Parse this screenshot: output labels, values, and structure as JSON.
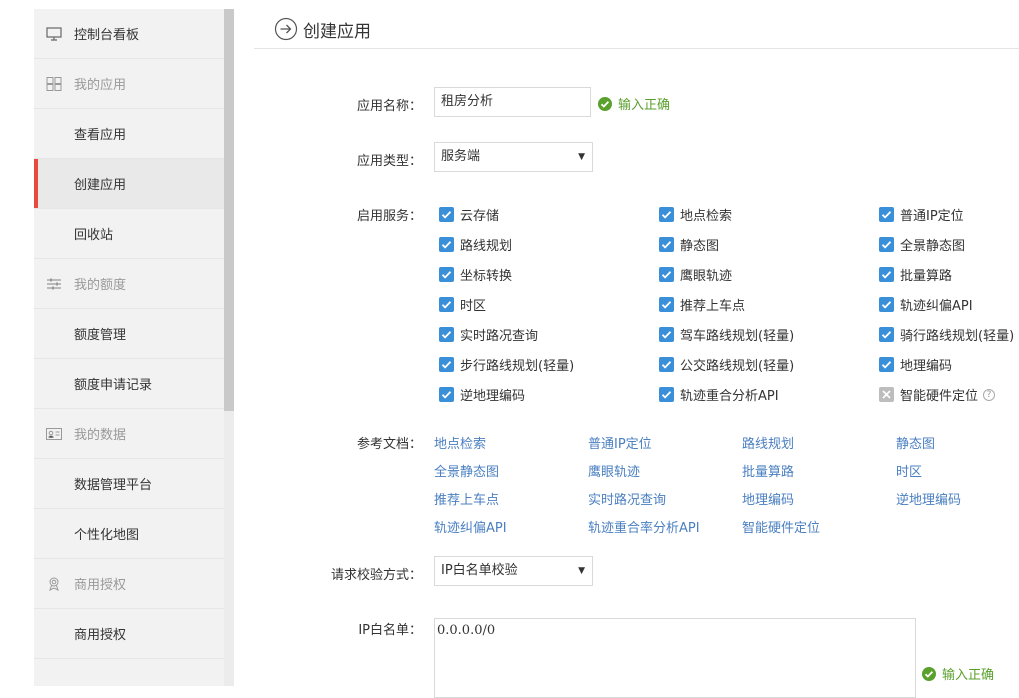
{
  "sidebar": {
    "items": [
      {
        "label": "控制台看板",
        "kind": "top",
        "icon": "monitor-icon"
      },
      {
        "label": "我的应用",
        "kind": "group",
        "icon": "grid-icon"
      },
      {
        "label": "查看应用",
        "kind": "sub"
      },
      {
        "label": "创建应用",
        "kind": "sub",
        "active": true
      },
      {
        "label": "回收站",
        "kind": "sub"
      },
      {
        "label": "我的额度",
        "kind": "group",
        "icon": "sliders-icon"
      },
      {
        "label": "额度管理",
        "kind": "sub"
      },
      {
        "label": "额度申请记录",
        "kind": "sub"
      },
      {
        "label": "我的数据",
        "kind": "group",
        "icon": "id-card-icon"
      },
      {
        "label": "数据管理平台",
        "kind": "sub"
      },
      {
        "label": "个性化地图",
        "kind": "sub"
      },
      {
        "label": "商用授权",
        "kind": "group",
        "icon": "award-icon"
      },
      {
        "label": "商用授权",
        "kind": "sub"
      }
    ]
  },
  "header": {
    "title": "创建应用"
  },
  "form": {
    "app_name": {
      "label": "应用名称：",
      "value": "租房分析",
      "valid": "输入正确"
    },
    "app_type": {
      "label": "应用类型：",
      "value": "服务端"
    },
    "services": {
      "label": "启用服务：",
      "items": [
        {
          "label": "云存储",
          "checked": true
        },
        {
          "label": "地点检索",
          "checked": true
        },
        {
          "label": "普通IP定位",
          "checked": true
        },
        {
          "label": "路线规划",
          "checked": true
        },
        {
          "label": "静态图",
          "checked": true
        },
        {
          "label": "全景静态图",
          "checked": true
        },
        {
          "label": "坐标转换",
          "checked": true
        },
        {
          "label": "鹰眼轨迹",
          "checked": true
        },
        {
          "label": "批量算路",
          "checked": true
        },
        {
          "label": "时区",
          "checked": true
        },
        {
          "label": "推荐上车点",
          "checked": true
        },
        {
          "label": "轨迹纠偏API",
          "checked": true
        },
        {
          "label": "实时路况查询",
          "checked": true
        },
        {
          "label": "驾车路线规划(轻量)",
          "checked": true
        },
        {
          "label": "骑行路线规划(轻量)",
          "checked": true
        },
        {
          "label": "步行路线规划(轻量)",
          "checked": true
        },
        {
          "label": "公交路线规划(轻量)",
          "checked": true
        },
        {
          "label": "地理编码",
          "checked": true
        },
        {
          "label": "逆地理编码",
          "checked": true
        },
        {
          "label": "轨迹重合分析API",
          "checked": true
        },
        {
          "label": "智能硬件定位",
          "checked": false,
          "help": "?"
        }
      ]
    },
    "docs": {
      "label": "参考文档：",
      "links": [
        "地点检索",
        "普通IP定位",
        "路线规划",
        "静态图",
        "全景静态图",
        "鹰眼轨迹",
        "批量算路",
        "时区",
        "推荐上车点",
        "实时路况查询",
        "地理编码",
        "逆地理编码",
        "轨迹纠偏API",
        "轨迹重合率分析API",
        "智能硬件定位"
      ]
    },
    "verify": {
      "label": "请求校验方式：",
      "value": "IP白名单校验"
    },
    "whitelist": {
      "label": "IP白名单：",
      "value": "0.0.0.0/0",
      "valid": "输入正确"
    }
  },
  "colors": {
    "accent": "#3a8fd9",
    "active_bar": "#e84a3c",
    "success": "#5aa02c",
    "link": "#4a7fc1"
  }
}
